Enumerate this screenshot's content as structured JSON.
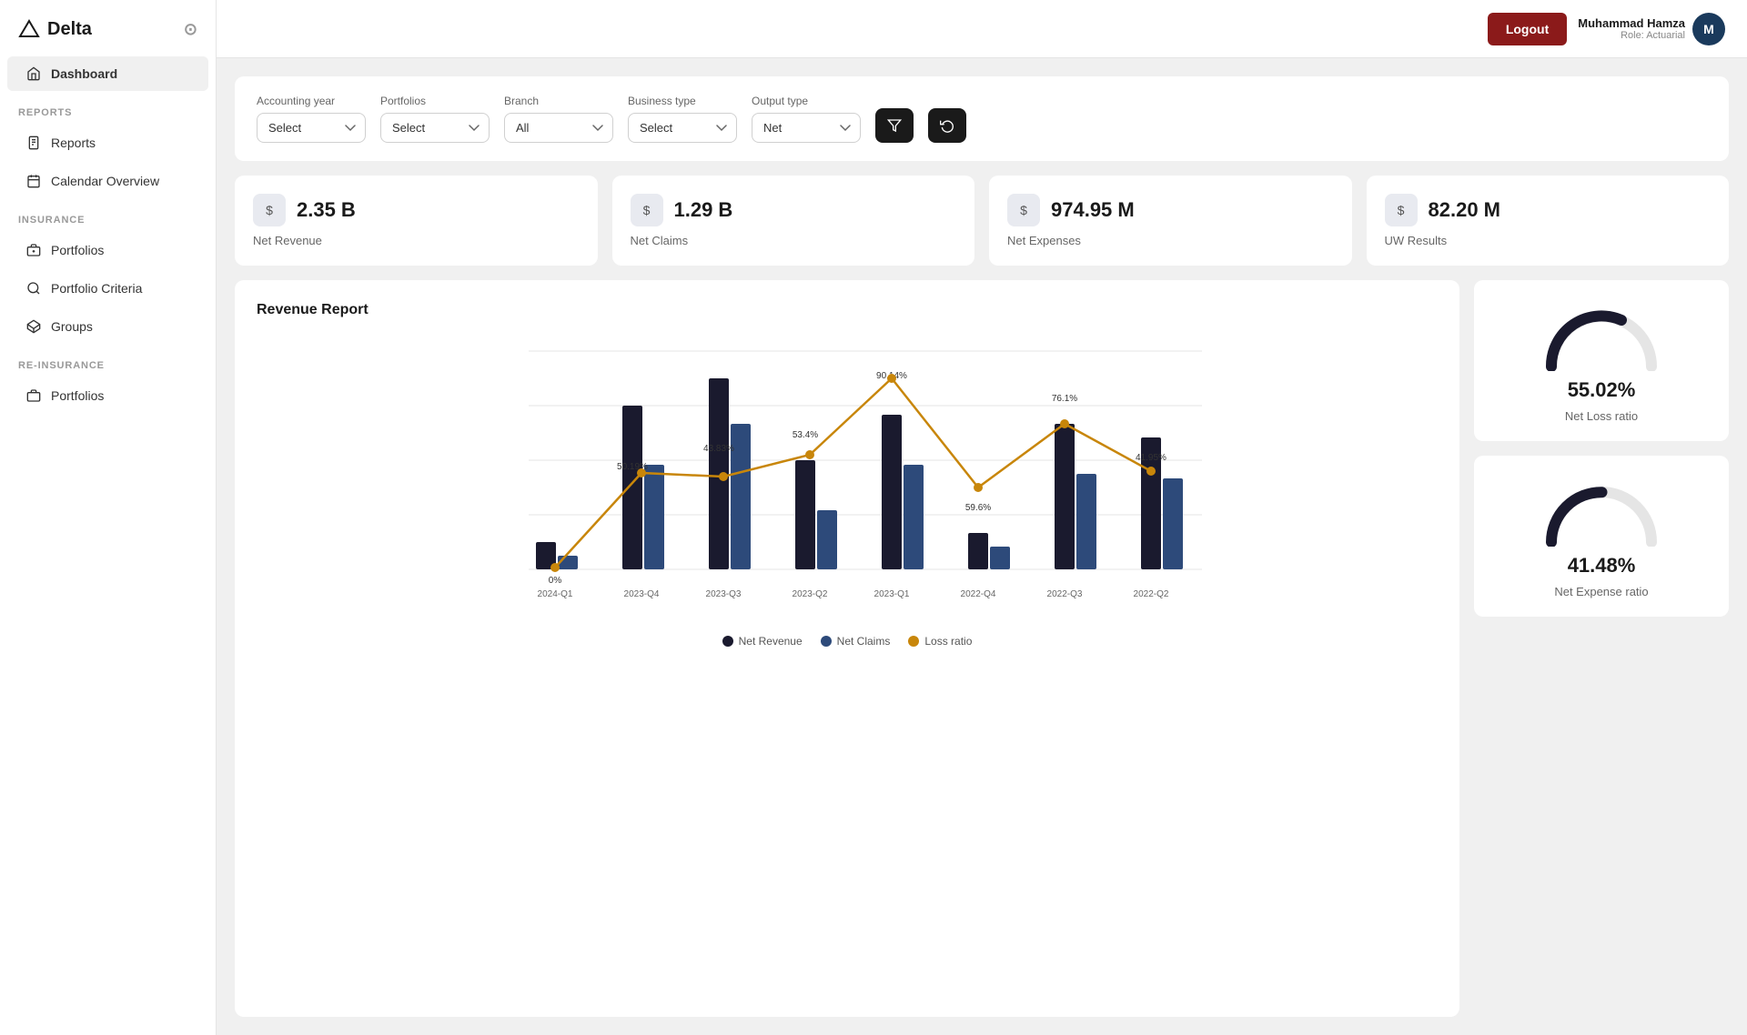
{
  "app": {
    "name": "Delta",
    "logo_alt": "Delta logo triangle"
  },
  "sidebar": {
    "dashboard_label": "Dashboard",
    "sections": [
      {
        "label": "REPORTS",
        "items": [
          {
            "id": "reports",
            "label": "Reports",
            "icon": "reports-icon"
          },
          {
            "id": "calendar",
            "label": "Calendar Overview",
            "icon": "calendar-icon"
          }
        ]
      },
      {
        "label": "INSURANCE",
        "items": [
          {
            "id": "ins-portfolios",
            "label": "Portfolios",
            "icon": "portfolios-icon"
          },
          {
            "id": "portfolio-criteria",
            "label": "Portfolio Criteria",
            "icon": "criteria-icon"
          },
          {
            "id": "groups",
            "label": "Groups",
            "icon": "groups-icon"
          }
        ]
      },
      {
        "label": "RE-INSURANCE",
        "items": [
          {
            "id": "re-portfolios",
            "label": "Portfolios",
            "icon": "portfolios-icon"
          }
        ]
      }
    ]
  },
  "header": {
    "logout_label": "Logout",
    "user_name": "Muhammad Hamza",
    "user_role": "Role: Actuarial",
    "avatar_initials": "M"
  },
  "filters": {
    "accounting_year_label": "Accounting year",
    "accounting_year_value": "Select",
    "portfolios_label": "Portfolios",
    "portfolios_value": "Select",
    "branch_label": "Branch",
    "branch_value": "All",
    "business_type_label": "Business type",
    "business_type_value": "Select",
    "output_type_label": "Output type",
    "output_type_value": "Net"
  },
  "stats": [
    {
      "id": "net-revenue",
      "value": "2.35 B",
      "label": "Net Revenue"
    },
    {
      "id": "net-claims",
      "value": "1.29 B",
      "label": "Net Claims"
    },
    {
      "id": "net-expenses",
      "value": "974.95 M",
      "label": "Net Expenses"
    },
    {
      "id": "uw-results",
      "value": "82.20 M",
      "label": "UW Results"
    }
  ],
  "chart": {
    "title": "Revenue Report",
    "quarters": [
      "2024-Q1",
      "2023-Q4",
      "2023-Q3",
      "2023-Q2",
      "2023-Q1",
      "2022-Q4",
      "2022-Q3",
      "2022-Q2"
    ],
    "net_revenue": [
      5,
      82,
      95,
      55,
      78,
      20,
      78,
      72
    ],
    "net_claims": [
      3,
      55,
      65,
      32,
      55,
      12,
      55,
      50
    ],
    "loss_ratio": [
      0,
      50.19,
      43.83,
      53.4,
      90.14,
      59.6,
      76.1,
      41.95
    ],
    "loss_ratio_labels": [
      "0%",
      "50.19%",
      "43.83%",
      "53.4%",
      "90.14%",
      "59.6%",
      "76.1%",
      "41.95%"
    ],
    "legend": [
      {
        "label": "Net Revenue",
        "color": "#1a1a2e"
      },
      {
        "label": "Net Claims",
        "color": "#2d4a7a"
      },
      {
        "label": "Loss ratio",
        "color": "#c8860a"
      }
    ]
  },
  "gauges": [
    {
      "id": "net-loss-ratio",
      "value": "55.02%",
      "label": "Net Loss ratio",
      "percent": 55.02
    },
    {
      "id": "net-expense-ratio",
      "value": "41.48%",
      "label": "Net Expense ratio",
      "percent": 41.48
    }
  ]
}
